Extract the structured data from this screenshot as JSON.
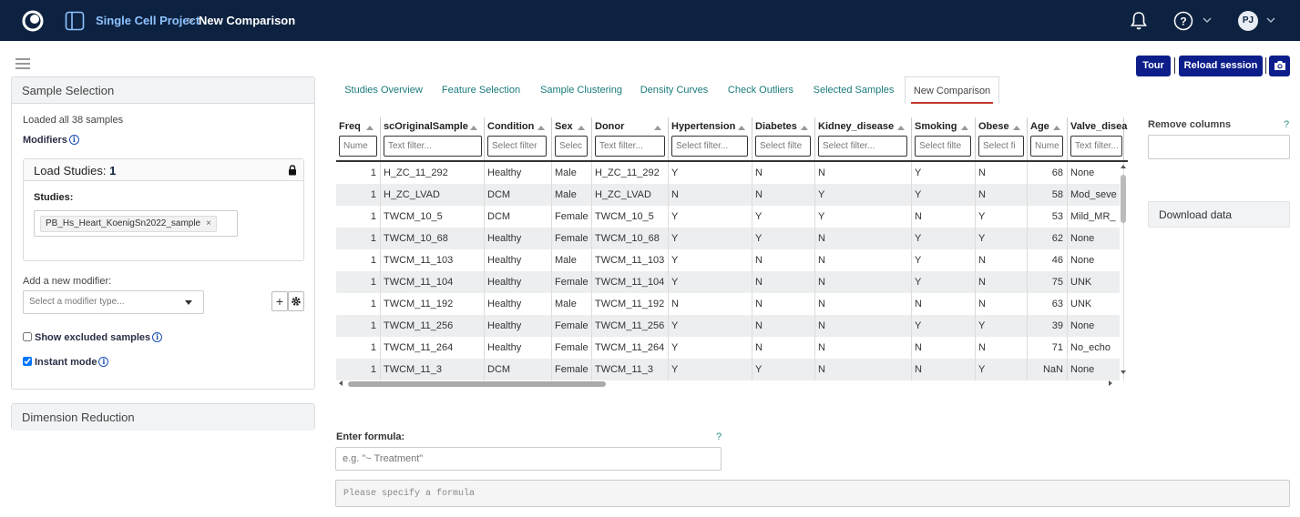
{
  "app": {
    "breadcrumb_project": "Single Cell Project",
    "breadcrumb_sep": ">",
    "breadcrumb_current": "New Comparison",
    "user_initials": "PJ",
    "icons": [
      "app-logo-icon",
      "panel-toggle-icon",
      "bell-icon",
      "help-icon",
      "chevron-down-icon",
      "lock-icon",
      "camera-icon",
      "gear-icon",
      "plus-icon",
      "hamburger-icon"
    ]
  },
  "sidebar": {
    "sample_selection_title": "Sample Selection",
    "loaded_text": "Loaded all 38 samples",
    "modifiers_label": "Modifiers",
    "load_studies_label": "Load Studies:",
    "load_studies_count": "1",
    "studies_label": "Studies:",
    "study_tag": "PB_Hs_Heart_KoenigSn2022_sample",
    "tag_remove": "×",
    "add_modifier_label": "Add a new modifier:",
    "modifier_placeholder": "Select a modifier type...",
    "add_button": "+",
    "show_excluded_label": "Show excluded samples",
    "show_excluded_checked": false,
    "instant_mode_label": "Instant mode",
    "instant_mode_checked": true,
    "dimension_reduction_title": "Dimension Reduction"
  },
  "toolbar": {
    "tour_label": "Tour",
    "reload_label": "Reload session",
    "sep": "|"
  },
  "tabs": [
    {
      "label": "Studies Overview",
      "active": false
    },
    {
      "label": "Feature Selection",
      "active": false
    },
    {
      "label": "Sample Clustering",
      "active": false
    },
    {
      "label": "Density Curves",
      "active": false
    },
    {
      "label": "Check Outliers",
      "active": false
    },
    {
      "label": "Selected Samples",
      "active": false
    },
    {
      "label": "New Comparison",
      "active": true
    }
  ],
  "table": {
    "columns": [
      {
        "title": "Freq",
        "filter": "Nume"
      },
      {
        "title": "scOriginalSample",
        "filter": "Text filter..."
      },
      {
        "title": "Condition",
        "filter": "Select filter"
      },
      {
        "title": "Sex",
        "filter": "Selec"
      },
      {
        "title": "Donor",
        "filter": "Text filter..."
      },
      {
        "title": "Hypertension",
        "filter": "Select filter..."
      },
      {
        "title": "Diabetes",
        "filter": "Select filte"
      },
      {
        "title": "Kidney_disease",
        "filter": "Select filter..."
      },
      {
        "title": "Smoking",
        "filter": "Select filte"
      },
      {
        "title": "Obese",
        "filter": "Select fi"
      },
      {
        "title": "Age",
        "filter": "Nume"
      },
      {
        "title": "Valve_disea",
        "filter": "Text filter..."
      }
    ],
    "rows": [
      [
        "1",
        "H_ZC_11_292",
        "Healthy",
        "Male",
        "H_ZC_11_292",
        "Y",
        "N",
        "N",
        "Y",
        "N",
        "68",
        "None"
      ],
      [
        "1",
        "H_ZC_LVAD",
        "DCM",
        "Male",
        "H_ZC_LVAD",
        "N",
        "N",
        "Y",
        "Y",
        "N",
        "58",
        "Mod_seve"
      ],
      [
        "1",
        "TWCM_10_5",
        "DCM",
        "Female",
        "TWCM_10_5",
        "Y",
        "Y",
        "Y",
        "N",
        "Y",
        "53",
        "Mild_MR_"
      ],
      [
        "1",
        "TWCM_10_68",
        "Healthy",
        "Female",
        "TWCM_10_68",
        "Y",
        "Y",
        "N",
        "Y",
        "Y",
        "62",
        "None"
      ],
      [
        "1",
        "TWCM_11_103",
        "Healthy",
        "Male",
        "TWCM_11_103",
        "Y",
        "N",
        "N",
        "Y",
        "N",
        "46",
        "None"
      ],
      [
        "1",
        "TWCM_11_104",
        "Healthy",
        "Female",
        "TWCM_11_104",
        "Y",
        "N",
        "N",
        "Y",
        "N",
        "75",
        "UNK"
      ],
      [
        "1",
        "TWCM_11_192",
        "Healthy",
        "Male",
        "TWCM_11_192",
        "N",
        "N",
        "N",
        "N",
        "N",
        "63",
        "UNK"
      ],
      [
        "1",
        "TWCM_11_256",
        "Healthy",
        "Female",
        "TWCM_11_256",
        "Y",
        "N",
        "N",
        "Y",
        "Y",
        "39",
        "None"
      ],
      [
        "1",
        "TWCM_11_264",
        "Healthy",
        "Female",
        "TWCM_11_264",
        "Y",
        "N",
        "N",
        "N",
        "N",
        "71",
        "No_echo"
      ],
      [
        "1",
        "TWCM_11_3",
        "DCM",
        "Female",
        "TWCM_11_3",
        "Y",
        "Y",
        "N",
        "N",
        "Y",
        "NaN",
        "None"
      ]
    ]
  },
  "right_panel": {
    "remove_columns_label": "Remove columns",
    "help": "?",
    "download_label": "Download data"
  },
  "formula": {
    "label": "Enter formula:",
    "help": "?",
    "placeholder": "e.g. \"~ Treatment\"",
    "output_text": "Please specify a formula"
  },
  "colors": {
    "topbar": "#0d2240",
    "primary_button": "#0d1e8a",
    "tab_link": "#1a7a7a",
    "active_tab_underline": "#c0392b"
  }
}
